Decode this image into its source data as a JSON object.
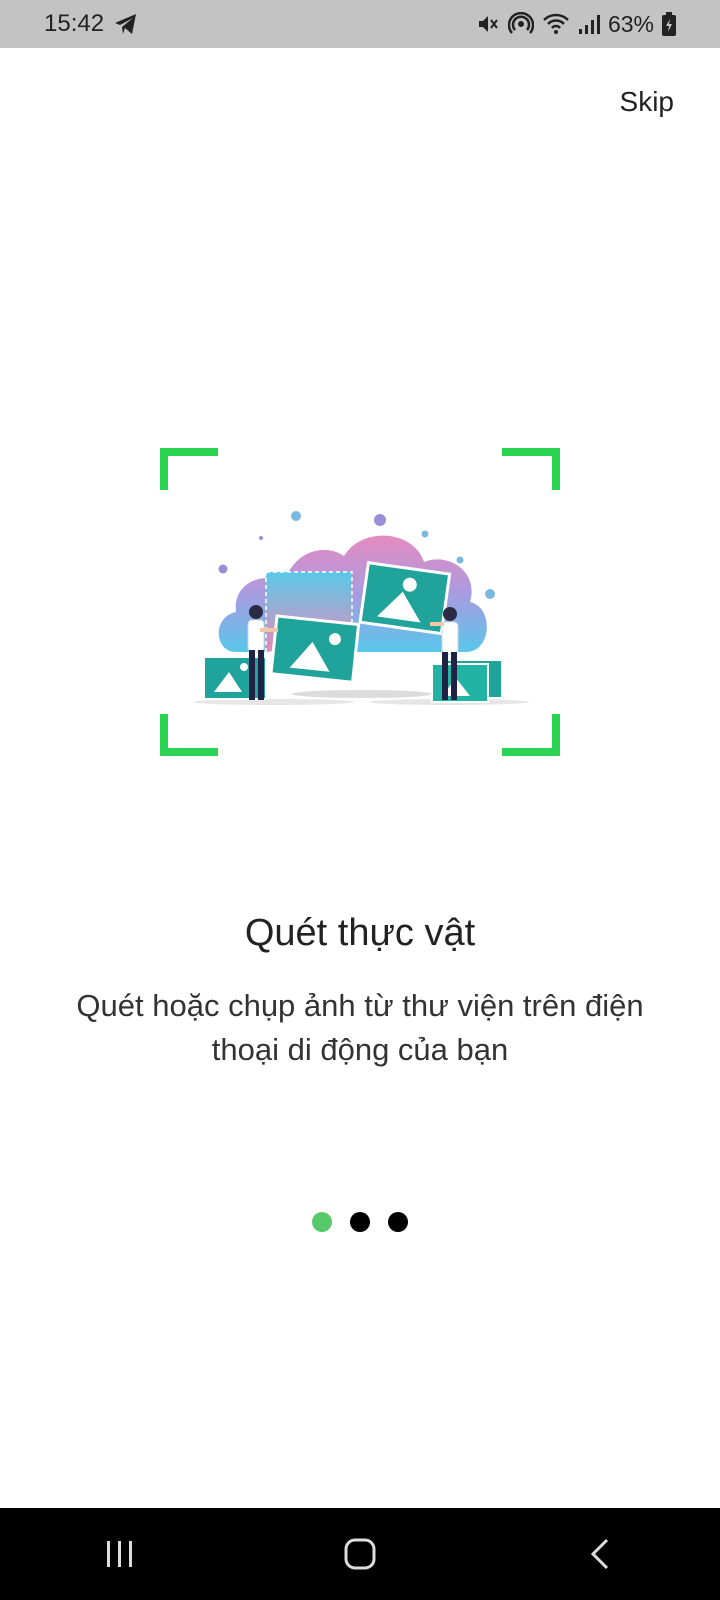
{
  "status_bar": {
    "time": "15:42",
    "battery_percent": "63%",
    "icons": [
      "telegram-icon",
      "mute-icon",
      "hotspot-icon",
      "wifi-icon",
      "signal-icon",
      "battery-icon"
    ]
  },
  "header": {
    "skip_label": "Skip"
  },
  "onboarding": {
    "title": "Quét thực vật",
    "description": "Quét hoặc chụp ảnh từ thư viện trên điện thoại di động của bạn",
    "page_indicator": {
      "current": 1,
      "total": 3
    },
    "accent_color": "#2ad452"
  },
  "nav_bar": {
    "buttons": [
      "recent-apps-icon",
      "home-icon",
      "back-icon"
    ]
  }
}
